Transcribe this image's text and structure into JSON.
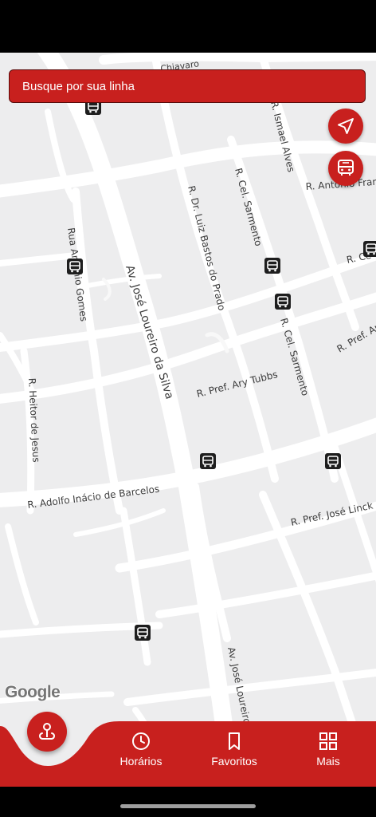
{
  "search": {
    "placeholder": "Busque por sua linha"
  },
  "map": {
    "provider": "Google",
    "streets": [
      "Chiavaro",
      "R. Ismael Alves",
      "R. Antônio Franco",
      "R. Cel. Sarmento",
      "R. Dr. Luiz Bastos do Prado",
      "Rua Antônio Gomes",
      "Av. José Loureiro da Silva",
      "R. Ce",
      "R. Cel. Sarmento",
      "R. Pref. Ary T",
      "R. Heitor de Jesus",
      "R. Pref. Ary Tubbs",
      "R. Adolfo Inácio de Barcelos",
      "R. Pref. José Linck",
      "Av. José Loureiro"
    ]
  },
  "actions": {
    "locate_icon": "navigation-arrow-icon",
    "bus_icon": "bus-icon"
  },
  "bottom_nav": {
    "center_icon": "pin-location-icon",
    "items": [
      {
        "label": "Horários",
        "icon": "clock-icon"
      },
      {
        "label": "Favoritos",
        "icon": "bookmark-icon"
      },
      {
        "label": "Mais",
        "icon": "grid-icon"
      }
    ]
  },
  "colors": {
    "brand_red": "#c8201e",
    "map_bg": "#ededee",
    "road": "#ffffff"
  }
}
